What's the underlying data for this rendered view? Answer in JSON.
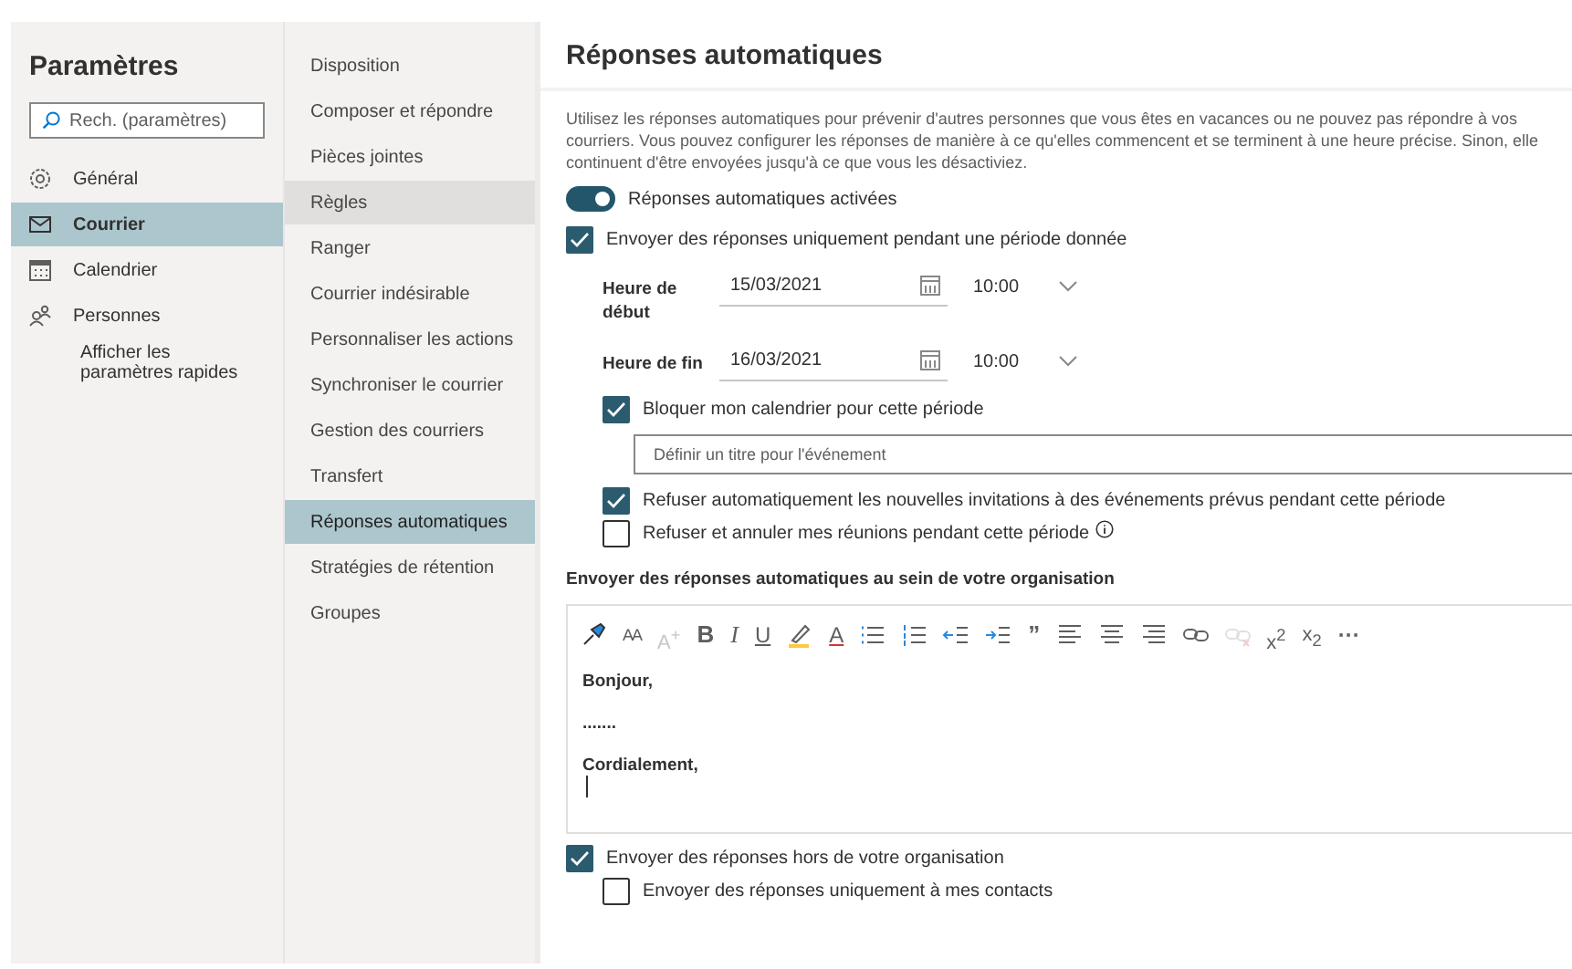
{
  "settings_nav": {
    "title": "Paramètres",
    "search": {
      "placeholder": "Rech. (paramètres)"
    },
    "items": [
      {
        "label": "Général",
        "selected": false
      },
      {
        "label": "Courrier",
        "selected": true
      },
      {
        "label": "Calendrier",
        "selected": false
      },
      {
        "label": "Personnes",
        "selected": false
      }
    ],
    "quick_link": "Afficher les paramètres rapides"
  },
  "mail_nav": {
    "items": [
      {
        "label": "Disposition",
        "selected": false,
        "hovered": false
      },
      {
        "label": "Composer et répondre",
        "selected": false,
        "hovered": false
      },
      {
        "label": "Pièces jointes",
        "selected": false,
        "hovered": false
      },
      {
        "label": "Règles",
        "selected": false,
        "hovered": true
      },
      {
        "label": "Ranger",
        "selected": false,
        "hovered": false
      },
      {
        "label": "Courrier indésirable",
        "selected": false,
        "hovered": false
      },
      {
        "label": "Personnaliser les actions",
        "selected": false,
        "hovered": false
      },
      {
        "label": "Synchroniser le courrier",
        "selected": false,
        "hovered": false
      },
      {
        "label": "Gestion des courriers",
        "selected": false,
        "hovered": false
      },
      {
        "label": "Transfert",
        "selected": false,
        "hovered": false
      },
      {
        "label": "Réponses automatiques",
        "selected": true,
        "hovered": false
      },
      {
        "label": "Stratégies de rétention",
        "selected": false,
        "hovered": false
      },
      {
        "label": "Groupes",
        "selected": false,
        "hovered": false
      }
    ]
  },
  "panel": {
    "title": "Réponses automatiques",
    "description": [
      "Utilisez les réponses automatiques pour prévenir d'autres personnes que vous êtes en vacances ou ne pouvez pas répondre à vos",
      "courriers. Vous pouvez configurer les réponses de manière à ce qu'elles commencent et se terminent à une heure précise. Sinon, elle",
      "continuent d'être envoyées jusqu'à ce que vous les désactiviez."
    ],
    "toggle": {
      "label": "Réponses automatiques activées",
      "on": true
    },
    "period": {
      "label": "Envoyer des réponses uniquement pendant une période donnée",
      "checked": true
    },
    "times": [
      {
        "label": "Heure de début",
        "date": "15/03/2021",
        "time": "10:00"
      },
      {
        "label": "Heure de fin",
        "date": "16/03/2021",
        "time": "10:00"
      }
    ],
    "block_calendar": {
      "label": "Bloquer mon calendrier pour cette période",
      "checked": true
    },
    "event_title": {
      "placeholder": "Définir un titre pour l'événement"
    },
    "options": [
      {
        "label": "Refuser automatiquement les nouvelles invitations à des événements prévus pendant cette période",
        "checked": true,
        "info": false
      },
      {
        "label": "Refuser et annuler mes réunions pendant cette période",
        "checked": false,
        "info": true
      }
    ],
    "internal": {
      "heading": "Envoyer des réponses automatiques au sein de votre organisation",
      "toolbar": [
        {
          "kind": "painter",
          "disabled": false
        },
        {
          "kind": "font-size",
          "glyph": "AA",
          "disabled": false
        },
        {
          "kind": "grow-font",
          "glyph": "A$^{+}$",
          "disabled": true
        },
        {
          "kind": "bold",
          "glyph": "B",
          "disabled": false
        },
        {
          "kind": "italic",
          "glyph": "I",
          "disabled": false
        },
        {
          "kind": "underline",
          "glyph": "U",
          "disabled": false
        },
        {
          "kind": "highlight",
          "disabled": false
        },
        {
          "kind": "font-color",
          "glyph": "A",
          "disabled": false
        },
        {
          "kind": "bullets",
          "disabled": false
        },
        {
          "kind": "numbering",
          "disabled": false
        },
        {
          "kind": "outdent",
          "disabled": false
        },
        {
          "kind": "indent",
          "disabled": false
        },
        {
          "kind": "quote",
          "glyph": "”",
          "disabled": false
        },
        {
          "kind": "align-left",
          "disabled": false
        },
        {
          "kind": "align-center",
          "disabled": false
        },
        {
          "kind": "align-right",
          "disabled": false
        },
        {
          "kind": "link",
          "disabled": false
        },
        {
          "kind": "unlink",
          "disabled": true
        },
        {
          "kind": "superscript",
          "glyph": "x$^{2}$",
          "disabled": false
        },
        {
          "kind": "subscript",
          "glyph": "x$_{2}$",
          "disabled": false
        },
        {
          "kind": "more",
          "glyph": "···",
          "disabled": false
        }
      ],
      "message": [
        "Bonjour,",
        ".......",
        "Cordialement,"
      ]
    },
    "external": {
      "label": "Envoyer des réponses hors de votre organisation",
      "checked": true
    },
    "contacts_only": {
      "label": "Envoyer des réponses uniquement à mes contacts",
      "checked": false
    }
  }
}
